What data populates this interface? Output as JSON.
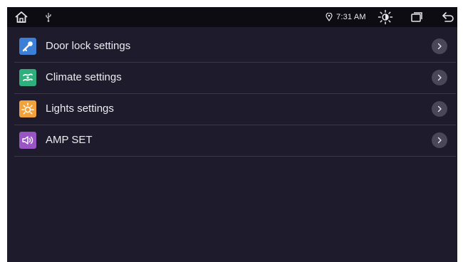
{
  "status_bar": {
    "time": "7:31 AM",
    "icons": [
      "home-icon",
      "usb-icon",
      "location-icon",
      "brightness-icon",
      "recent-apps-icon",
      "back-icon"
    ]
  },
  "settings": {
    "items": [
      {
        "label": "Door lock settings",
        "icon": "key-icon",
        "icon_color": "#3d7fd6"
      },
      {
        "label": "Climate settings",
        "icon": "fan-icon",
        "icon_color": "#2fae7e"
      },
      {
        "label": "Lights settings",
        "icon": "sun-icon",
        "icon_color": "#f1a23a"
      },
      {
        "label": "AMP SET",
        "icon": "speaker-icon",
        "icon_color": "#9a55c4"
      }
    ]
  },
  "colors": {
    "background": "#1e1b2c",
    "status_bar": "#0d0c13",
    "divider": "#3a3748",
    "chevron_bg": "#4a4758"
  }
}
